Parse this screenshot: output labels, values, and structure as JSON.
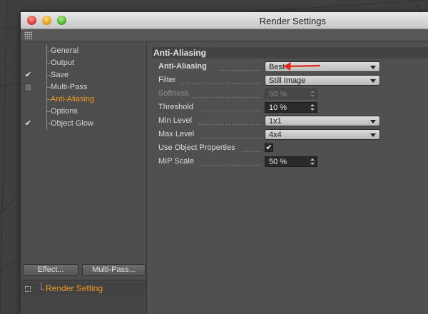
{
  "window": {
    "title": "Render Settings"
  },
  "sidebar": {
    "items": [
      {
        "label": "General",
        "check": "none",
        "active": false
      },
      {
        "label": "Output",
        "check": "none",
        "active": false
      },
      {
        "label": "Save",
        "check": "checked",
        "active": false
      },
      {
        "label": "Multi-Pass",
        "check": "unchecked",
        "active": false
      },
      {
        "label": "Anti-Aliasing",
        "check": "none",
        "active": true
      },
      {
        "label": "Options",
        "check": "none",
        "active": false
      },
      {
        "label": "Object Glow",
        "check": "checked",
        "active": false
      }
    ],
    "effect_button": "Effect...",
    "multipass_button": "Multi-Pass...",
    "render_setting": "Render Setting"
  },
  "main": {
    "section_title": "Anti-Aliasing",
    "anti_aliasing": {
      "label": "Anti-Aliasing",
      "value": "Best"
    },
    "filter": {
      "label": "Filter",
      "value": "Still Image"
    },
    "softness": {
      "label": "Softness",
      "value": "50 %"
    },
    "threshold": {
      "label": "Threshold",
      "value": "10 %"
    },
    "min_level": {
      "label": "Min Level",
      "value": "1x1"
    },
    "max_level": {
      "label": "Max Level",
      "value": "4x4"
    },
    "use_object_properties": {
      "label": "Use Object Properties",
      "checked": true
    },
    "mip_scale": {
      "label": "MIP Scale",
      "value": "50 %"
    }
  },
  "colors": {
    "accent": "#f39a1d",
    "annotation": "#e02a1e"
  }
}
